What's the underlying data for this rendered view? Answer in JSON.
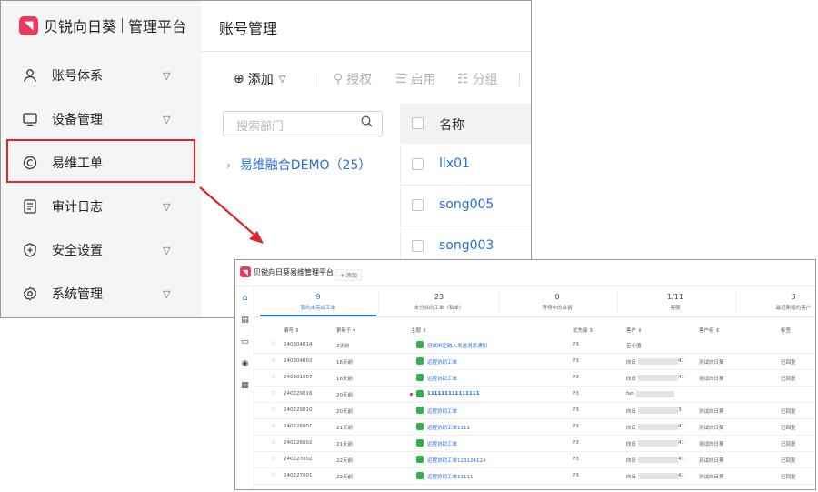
{
  "main": {
    "logo": {
      "brand": "贝锐向日葵",
      "product": "管理平台",
      "mark": "◥"
    },
    "sidebar": {
      "items": [
        {
          "label": "账号体系",
          "icon": "user-icon"
        },
        {
          "label": "设备管理",
          "icon": "monitor-icon"
        },
        {
          "label": "易维工单",
          "icon": "ticket-icon",
          "highlighted": true
        },
        {
          "label": "审计日志",
          "icon": "log-icon"
        },
        {
          "label": "安全设置",
          "icon": "shield-icon"
        },
        {
          "label": "系统管理",
          "icon": "gear-icon"
        }
      ]
    },
    "page_title": "账号管理",
    "toolbar": {
      "add": "添加",
      "authorize": "授权",
      "enable": "启用",
      "group": "分组"
    },
    "search_placeholder": "搜索部门",
    "tree": {
      "node": "易维融合DEMO（25）"
    },
    "table": {
      "header": "名称",
      "rows": [
        "llx01",
        "song005",
        "song003"
      ]
    }
  },
  "inset": {
    "logo": "贝锐向日葵易维管理平台",
    "tab": "+ 添加",
    "stats": [
      {
        "n": "9",
        "l": "我的未完成工单"
      },
      {
        "n": "23",
        "l": "未分派的工单（私单）"
      },
      {
        "n": "0",
        "l": "等待中的会话"
      },
      {
        "n": "1/11",
        "l": "客服"
      },
      {
        "n": "3",
        "l": "最近新增的客户"
      }
    ],
    "columns": [
      "编号 ⇕",
      "更新于 ▾",
      "主题 ⇕",
      "优先级 ⇕",
      "客户 ⇕",
      "客户组 ⇕",
      "标签"
    ],
    "rows": [
      {
        "id": "240304014",
        "updated": "2天前",
        "subject": "测试绑定融入发送消息通知",
        "priority": "P3",
        "customer": "苗小值",
        "group": "",
        "tag": ""
      },
      {
        "id": "240304002",
        "updated": "16天前",
        "subject": "远程协助工单",
        "priority": "P3",
        "customer": "向日",
        "cust_suffix": "41",
        "group": "测试向日葵",
        "tag": "已回复"
      },
      {
        "id": "240301007",
        "updated": "16天前",
        "subject": "远程协助工单",
        "priority": "P3",
        "customer": "向日",
        "cust_suffix": "41",
        "group": "测试向日葵",
        "tag": "已回复"
      },
      {
        "id": "240229016",
        "updated": "20天前",
        "subject": "111111111111111",
        "priority": "P3",
        "customer": "fan",
        "cust_suffix": "",
        "group": "",
        "tag": "",
        "unread": true
      },
      {
        "id": "240229010",
        "updated": "20天前",
        "subject": "远程协助工单",
        "priority": "P3",
        "customer": "向日",
        "cust_suffix": "3",
        "group": "测试向日葵",
        "tag": "已回复"
      },
      {
        "id": "240226001",
        "updated": "21天前",
        "subject": "远程协助工单1111",
        "priority": "P3",
        "customer": "向日",
        "cust_suffix": "41",
        "group": "测试向日葵",
        "tag": "已回复"
      },
      {
        "id": "240226002",
        "updated": "21天前",
        "subject": "远程协助工单",
        "priority": "P3",
        "customer": "向日",
        "cust_suffix": "41",
        "group": "测试向日葵",
        "tag": "已回复"
      },
      {
        "id": "240227002",
        "updated": "22天前",
        "subject": "远程协助工单123124124",
        "priority": "P3",
        "customer": "向日",
        "cust_suffix": "41",
        "group": "测试向日葵",
        "tag": "已回复"
      },
      {
        "id": "240227001",
        "updated": "22天前",
        "subject": "远程协助工单11111",
        "priority": "P3",
        "customer": "向日",
        "cust_suffix": "41",
        "group": "测试向日葵",
        "tag": "已回复"
      }
    ]
  },
  "colors": {
    "accent": "#2a6ed6",
    "brand": "#e83a5f",
    "highlight": "#e0262b",
    "green": "#2fb24a"
  }
}
